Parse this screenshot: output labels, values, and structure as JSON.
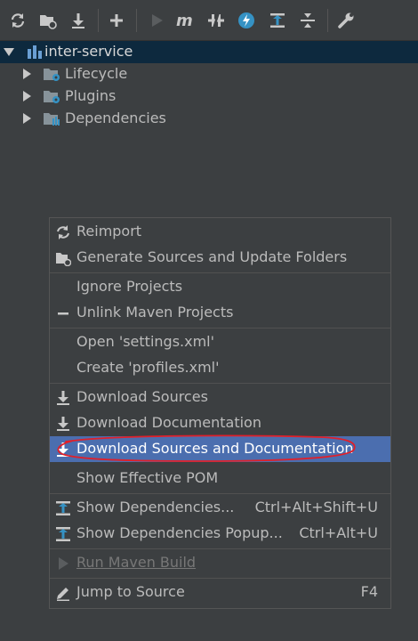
{
  "toolbar": {
    "icons": [
      "reimport-icon",
      "generate-sources-icon",
      "download-icon",
      "add-icon",
      "run-icon",
      "maven-goal-icon",
      "toggle-offline-icon",
      "skip-tests-icon",
      "show-dependencies-icon",
      "collapse-all-icon",
      "settings-wrench-icon"
    ]
  },
  "tree": {
    "project": "inter-service",
    "children": [
      "Lifecycle",
      "Plugins",
      "Dependencies"
    ]
  },
  "menu": {
    "reimport": "Reimport",
    "generate_sources": "Generate Sources and Update Folders",
    "ignore_projects": "Ignore Projects",
    "unlink_projects": "Unlink Maven Projects",
    "open_settings": "Open 'settings.xml'",
    "create_profiles": "Create 'profiles.xml'",
    "download_sources": "Download Sources",
    "download_documentation": "Download Documentation",
    "download_sources_and_docs": "Download Sources and Documentation",
    "show_effective_pom": "Show Effective POM",
    "show_dependencies": "Show Dependencies...",
    "show_dependencies_shortcut": "Ctrl+Alt+Shift+U",
    "show_dependencies_popup": "Show Dependencies Popup...",
    "show_dependencies_popup_shortcut": "Ctrl+Alt+U",
    "run_maven_build": "Run Maven Build",
    "jump_to_source": "Jump to Source",
    "jump_to_source_shortcut": "F4"
  },
  "colors": {
    "background": "#3c3f41",
    "selection": "#0d293e",
    "highlight": "#4b6eaf",
    "annotation": "#e0202a",
    "icon_blue": "#3592c4"
  }
}
